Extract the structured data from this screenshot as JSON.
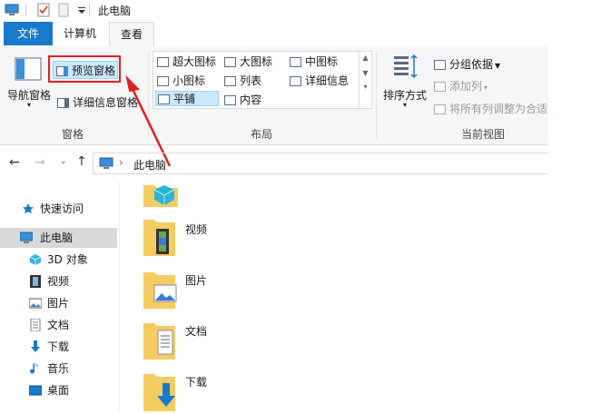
{
  "window": {
    "title": "此电脑"
  },
  "tabs": {
    "file": "文件",
    "computer": "计算机",
    "view": "查看"
  },
  "ribbon": {
    "pane_group": {
      "label": "窗格",
      "nav_pane": "导航窗格",
      "preview_pane": "预览窗格",
      "details_pane": "详细信息窗格"
    },
    "layout_group": {
      "label": "布局",
      "items": [
        "超大图标",
        "大图标",
        "中图标",
        "小图标",
        "列表",
        "详细信息",
        "平铺",
        "内容"
      ]
    },
    "view_group": {
      "label": "当前视图",
      "sort_by": "排序方式",
      "group_by": "分组依据",
      "add_column": "添加列",
      "fit_columns": "将所有列调整为合适"
    }
  },
  "address": {
    "path": "此电脑",
    "separator": "›"
  },
  "nav": {
    "items": [
      {
        "label": "快速访问",
        "icon": "star-pin-icon"
      },
      {
        "label": "此电脑",
        "icon": "computer-icon"
      },
      {
        "label": "3D 对象",
        "icon": "cube-icon"
      },
      {
        "label": "视频",
        "icon": "film-icon"
      },
      {
        "label": "图片",
        "icon": "picture-icon"
      },
      {
        "label": "文档",
        "icon": "document-icon"
      },
      {
        "label": "下载",
        "icon": "download-arrow-icon"
      },
      {
        "label": "音乐",
        "icon": "music-note-icon"
      },
      {
        "label": "桌面",
        "icon": "desktop-icon"
      }
    ]
  },
  "content": {
    "folders": [
      {
        "label": "",
        "icon": "3d-objects-folder-icon"
      },
      {
        "label": "视频",
        "icon": "videos-folder-icon"
      },
      {
        "label": "图片",
        "icon": "pictures-folder-icon"
      },
      {
        "label": "文档",
        "icon": "documents-folder-icon"
      },
      {
        "label": "下载",
        "icon": "downloads-folder-icon"
      }
    ]
  },
  "colors": {
    "accent": "#1979ca",
    "highlight": "#cce8ff",
    "annotation_red": "#e02020"
  }
}
